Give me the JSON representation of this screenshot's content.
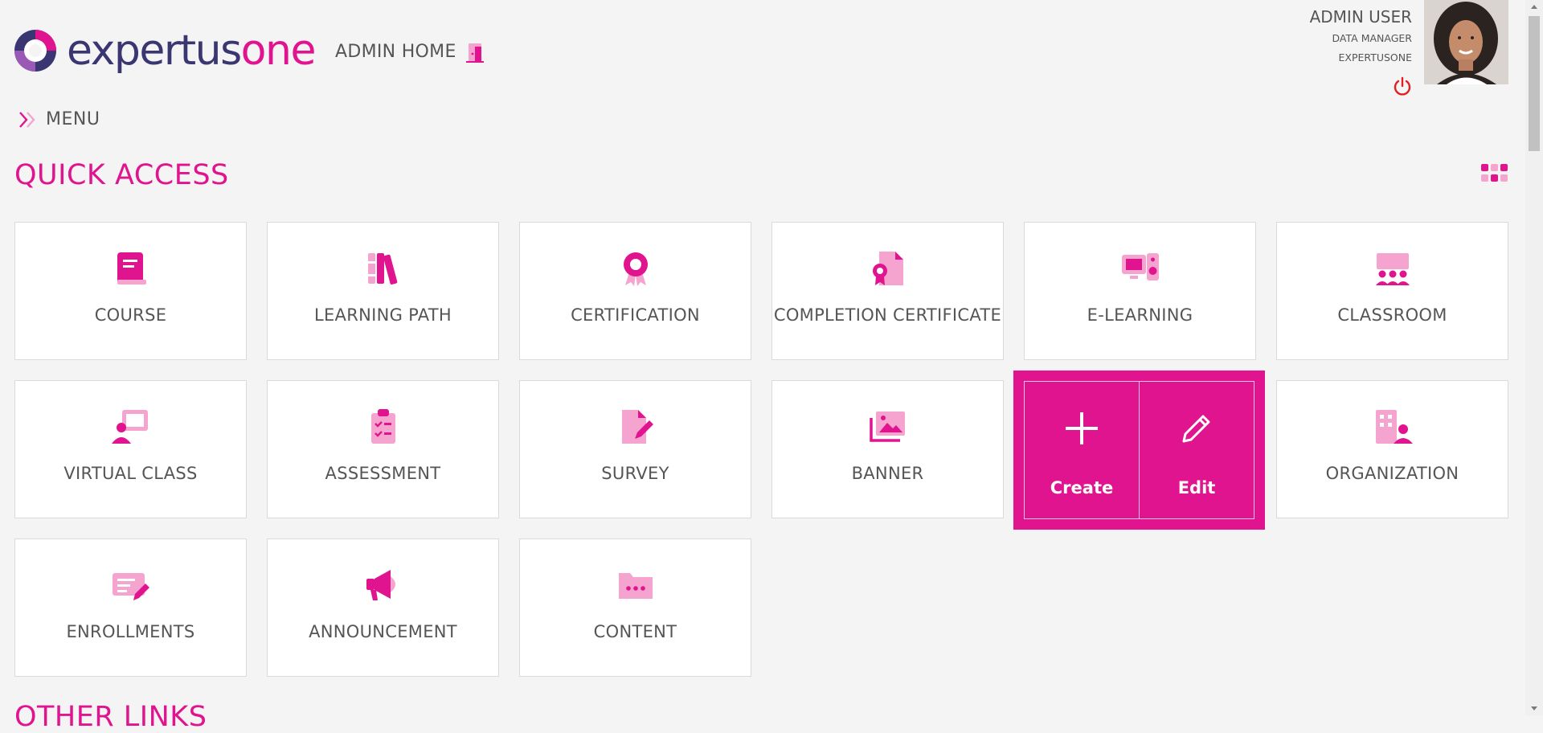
{
  "header": {
    "logo_part1": "expertus",
    "logo_part2": "one",
    "admin_home": "ADMIN HOME"
  },
  "user": {
    "name": "ADMIN USER",
    "role": "DATA MANAGER",
    "org": "EXPERTUSONE"
  },
  "menu": {
    "label": "MENU"
  },
  "quick_access": {
    "title": "QUICK ACCESS",
    "tiles": [
      {
        "label": "COURSE",
        "icon": "book-icon"
      },
      {
        "label": "LEARNING PATH",
        "icon": "books-icon"
      },
      {
        "label": "CERTIFICATION",
        "icon": "award-ribbon-icon"
      },
      {
        "label": "COMPLETION CERTIFICATE",
        "icon": "certificate-document-icon"
      },
      {
        "label": "E-LEARNING",
        "icon": "computer-speaker-icon"
      },
      {
        "label": "CLASSROOM",
        "icon": "classroom-icon"
      },
      {
        "label": "VIRTUAL CLASS",
        "icon": "virtual-class-icon"
      },
      {
        "label": "ASSESSMENT",
        "icon": "clipboard-checklist-icon"
      },
      {
        "label": "SURVEY",
        "icon": "document-edit-icon"
      },
      {
        "label": "BANNER",
        "icon": "images-icon"
      },
      {
        "label": "ORGANIZATION",
        "icon": "building-user-icon"
      },
      {
        "label": "ENROLLMENTS",
        "icon": "list-edit-icon"
      },
      {
        "label": "ANNOUNCEMENT",
        "icon": "megaphone-icon"
      },
      {
        "label": "CONTENT",
        "icon": "folder-icon"
      }
    ],
    "hover_actions": {
      "create": "Create",
      "edit": "Edit"
    }
  },
  "other_links": {
    "title": "OTHER LINKS"
  },
  "colors": {
    "accent": "#e0148f",
    "accent_light": "#f5a3cf",
    "logo_navy": "#3a3672",
    "power_red": "#e02020"
  }
}
